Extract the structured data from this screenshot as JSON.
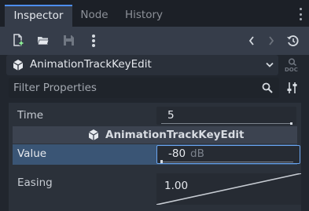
{
  "tabs": [
    {
      "label": "Inspector",
      "active": true
    },
    {
      "label": "Node",
      "active": false
    },
    {
      "label": "History",
      "active": false
    }
  ],
  "toolbar": {
    "icons": [
      "new-resource-icon",
      "load-resource-icon",
      "save-resource-icon",
      "kebab-menu-icon",
      "back-icon",
      "forward-icon",
      "history-icon"
    ]
  },
  "object": {
    "name": "AnimationTrackKeyEdit",
    "doc_label": "DOC"
  },
  "filter": {
    "placeholder": "Filter Properties"
  },
  "properties": {
    "time_label": "Time",
    "time_value": "5",
    "section_title": "AnimationTrackKeyEdit",
    "value_label": "Value",
    "value_value": "-80",
    "value_unit": "dB",
    "easing_label": "Easing",
    "easing_value": "1.00"
  },
  "colors": {
    "accent": "#4d8ef5",
    "selected_row": "#3a5575",
    "focus_border": "#6aa5f0",
    "panel_bg": "#2b313a"
  }
}
